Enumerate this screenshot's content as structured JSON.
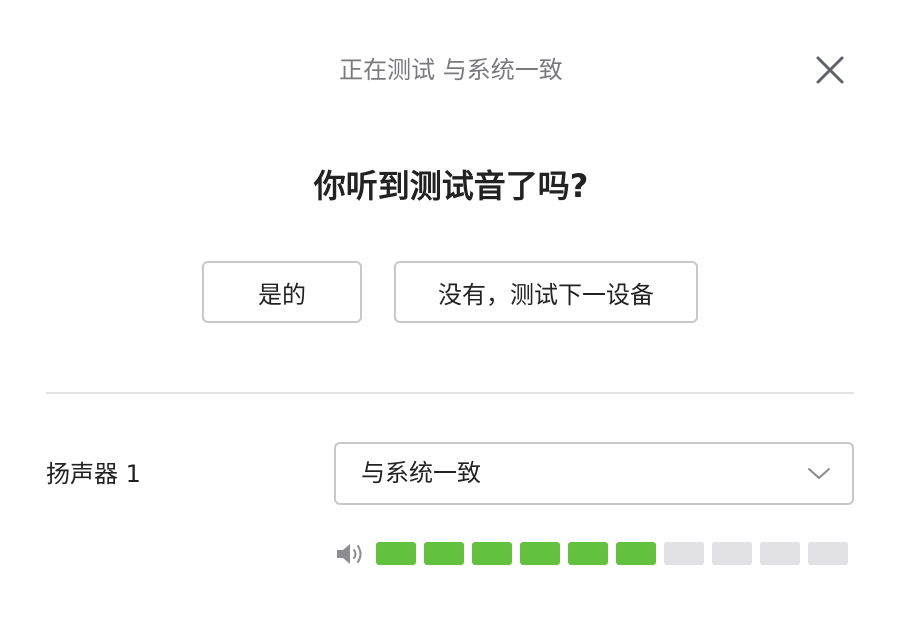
{
  "dialog": {
    "status_title": "正在测试 与系统一致",
    "close_icon": "close-icon",
    "question": "你听到测试音了吗?",
    "yes_label": "是的",
    "no_label": "没有，测试下一设备"
  },
  "speaker": {
    "label": "扬声器 1",
    "selected_value": "与系统一致",
    "dropdown_icon": "chevron-down-icon"
  },
  "volume_meter": {
    "icon": "speaker-volume-icon",
    "total_segments": 10,
    "active_segments": 6,
    "active_color": "#62c13f",
    "inactive_color": "#e2e2e6"
  }
}
